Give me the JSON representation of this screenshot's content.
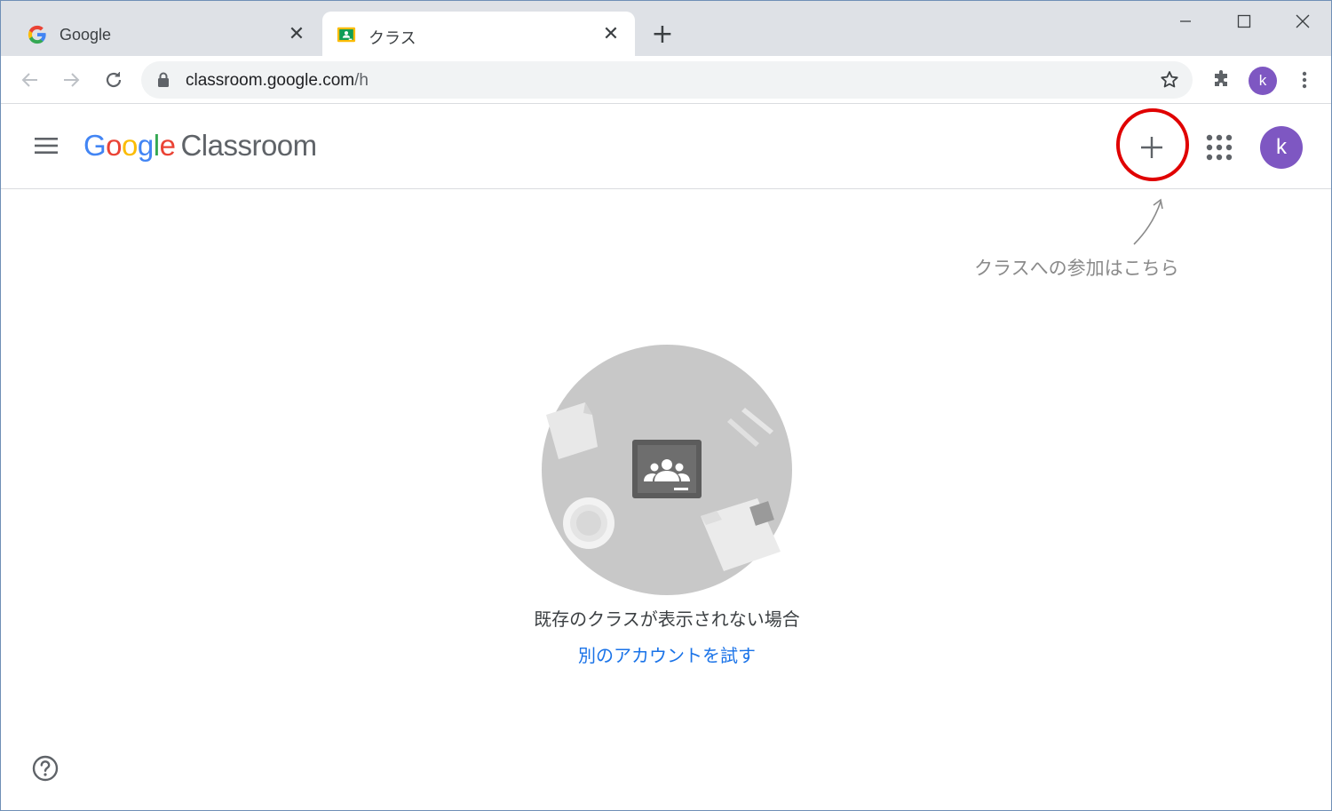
{
  "browser": {
    "tabs": [
      {
        "title": "Google",
        "favicon": "google-g-icon",
        "active": false
      },
      {
        "title": "クラス",
        "favicon": "classroom-icon",
        "active": true
      }
    ],
    "new_tab_label": "+",
    "close_label": "✕",
    "address_host": "classroom.google.com",
    "address_path": "/h",
    "profile_initial": "k"
  },
  "app": {
    "logo_letters": [
      "G",
      "o",
      "o",
      "g",
      "l",
      "e"
    ],
    "logo_product": "Classroom",
    "profile_initial": "k",
    "create_join_icon": "plus-icon"
  },
  "annotation": {
    "text": "クラスへの参加はこちら",
    "highlight_color": "#e00000"
  },
  "empty_state": {
    "message": "既存のクラスが表示されない場合",
    "link_text": "別のアカウントを試す"
  },
  "colors": {
    "accent": "#1a73e8",
    "avatar": "#7e57c2",
    "tabstrip": "#dee1e6"
  }
}
